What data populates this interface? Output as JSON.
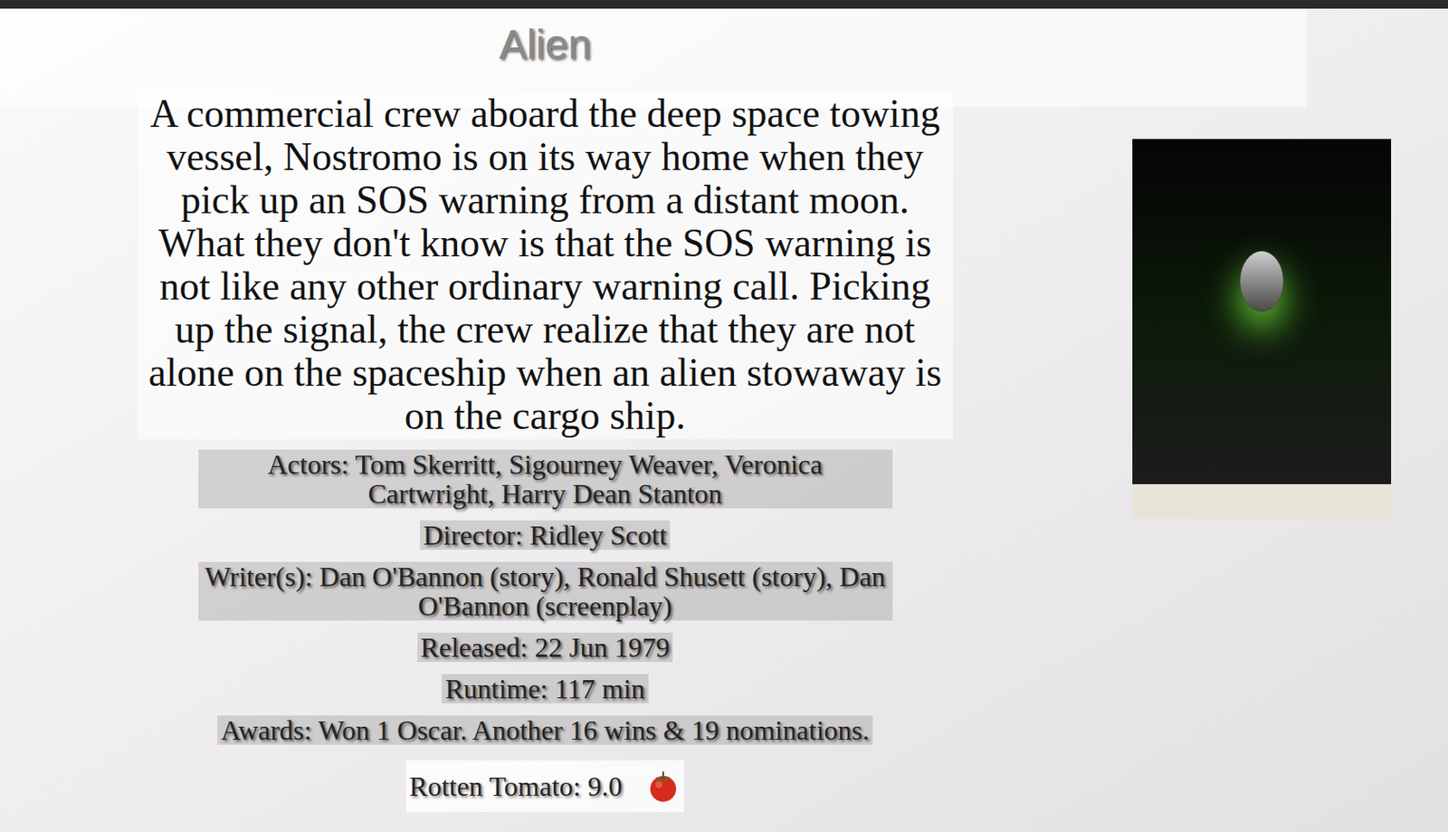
{
  "title": "Alien",
  "plot": "A commercial crew aboard the deep space towing vessel, Nostromo is on its way home when they pick up an SOS warning from a distant moon. What they don't know is that the SOS warning is not like any other ordinary warning call. Picking up the signal, the crew realize that they are not alone on the spaceship when an alien stowaway is on the cargo ship.",
  "details": [
    "Actors: Tom Skerritt, Sigourney Weaver, Veronica Cartwright, Harry Dean Stanton",
    "Director: Ridley Scott",
    "Writer(s): Dan O'Bannon (story), Ronald Shusett (story), Dan O'Bannon (screenplay)",
    "Released: 22 Jun 1979",
    "Runtime: 117 min",
    "Awards: Won 1 Oscar. Another 16 wins & 19 nominations."
  ],
  "rating": {
    "text": "Rotten Tomato: 9.0"
  }
}
